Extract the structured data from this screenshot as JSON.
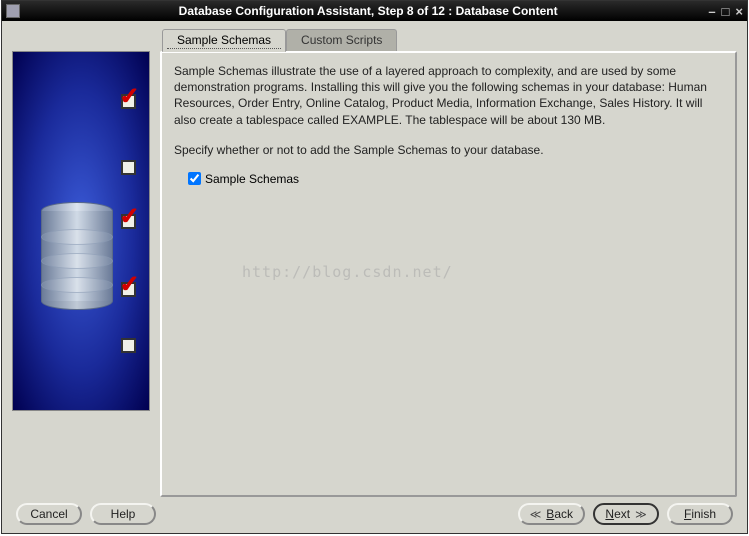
{
  "window": {
    "title": "Database Configuration Assistant, Step 8 of 12 : Database Content"
  },
  "tabs": {
    "sample": "Sample Schemas",
    "custom": "Custom Scripts"
  },
  "content": {
    "para1": "Sample Schemas illustrate the use of a layered approach to complexity, and are used by some demonstration programs. Installing this will give you the following schemas in your database: Human Resources, Order Entry, Online Catalog, Product Media, Information Exchange, Sales History. It will also create a tablespace called EXAMPLE. The tablespace will be about 130 MB.",
    "para2": "Specify whether or not to add the Sample Schemas to your database.",
    "checkbox_label": "Sample Schemas"
  },
  "buttons": {
    "cancel": "Cancel",
    "help": "Help",
    "back_char": "B",
    "back_rest": "ack",
    "next_char": "N",
    "next_rest": "ext",
    "finish_char": "F",
    "finish_rest": "inish"
  },
  "watermark": "http://blog.csdn.net/"
}
